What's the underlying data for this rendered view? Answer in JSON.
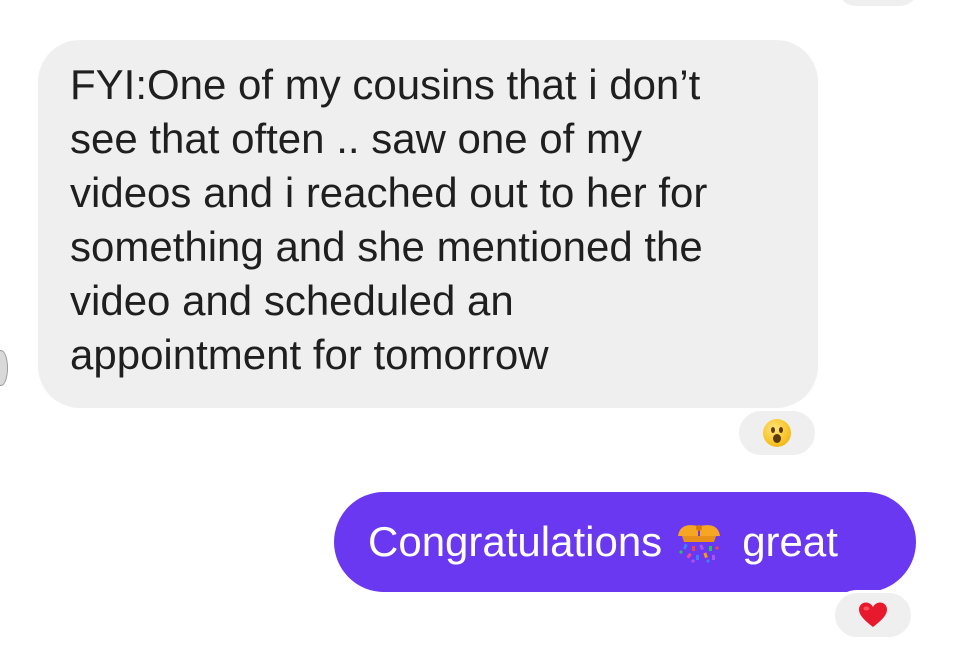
{
  "conversation": {
    "incoming_message": {
      "text": "FYI:One of my cousins that i don’t\nsee that often .. saw one of my\nvideos and i reached out to her for\nsomething and she mentioned the\nvideo and scheduled an\nappointment for tomorrow",
      "reaction_icon": "astonished-face-emoji"
    },
    "outgoing_message": {
      "text_before_emoji": "Congratulations",
      "emoji_icon": "confetti-ball-emoji",
      "text_after_emoji": "great",
      "reaction_icon": "red-heart-emoji"
    }
  },
  "colors": {
    "incoming_bubble": "#efefef",
    "outgoing_bubble": "#6a38f0",
    "heart": "#e8192c"
  }
}
